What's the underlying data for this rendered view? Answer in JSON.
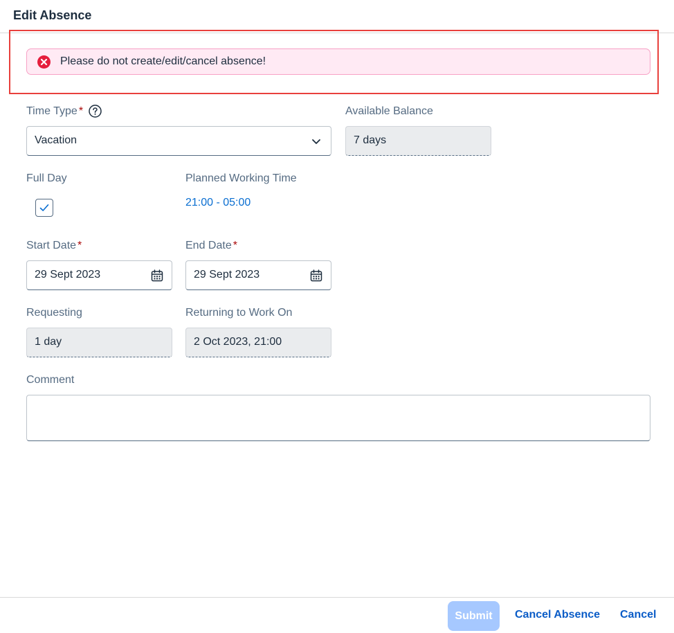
{
  "dialog": {
    "title": "Edit Absence"
  },
  "message_strip": {
    "text": "Please do not create/edit/cancel absence!",
    "type": "error"
  },
  "form": {
    "time_type": {
      "label": "Time Type",
      "required_mark": "*",
      "value": "Vacation"
    },
    "available_balance": {
      "label": "Available Balance",
      "value": "7 days"
    },
    "full_day": {
      "label": "Full Day",
      "checked": true
    },
    "planned_working_time": {
      "label": "Planned Working Time",
      "value": "21:00 - 05:00"
    },
    "start_date": {
      "label": "Start Date",
      "required_mark": "*",
      "value": "29 Sept 2023"
    },
    "end_date": {
      "label": "End Date",
      "required_mark": "*",
      "value": "29 Sept 2023"
    },
    "requesting": {
      "label": "Requesting",
      "value": "1 day"
    },
    "returning": {
      "label": "Returning to Work On",
      "value": "2 Oct 2023, 21:00"
    },
    "comment": {
      "label": "Comment",
      "value": ""
    }
  },
  "footer": {
    "submit_label": "Submit",
    "cancel_absence_label": "Cancel Absence",
    "cancel_label": "Cancel"
  },
  "icons": {
    "error": "error-icon",
    "help": "question-mark-icon",
    "dropdown": "chevron-down-icon",
    "calendar": "calendar-icon",
    "check": "checkmark-icon"
  },
  "colors": {
    "error": "#e51e3c",
    "strip_bg": "#ffeaf4",
    "highlight_frame": "#e8403c",
    "link": "#0a6ed1",
    "button_text": "#0a5cc7",
    "submit_disabled_bg": "#a6c8ff",
    "required": "#aa0808"
  }
}
